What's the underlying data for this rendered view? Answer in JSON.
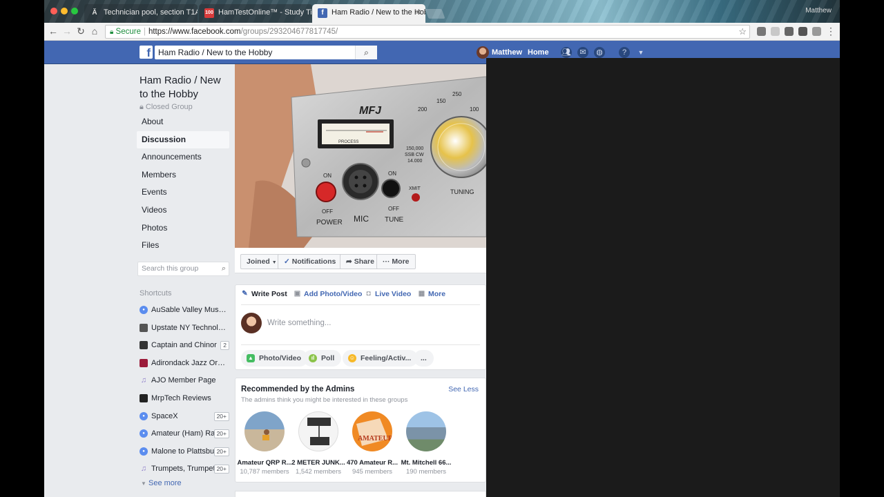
{
  "browser": {
    "tabs": [
      {
        "label": "Technician pool, section T1A",
        "active": false
      },
      {
        "label": "HamTestOnline™ - Study Tips",
        "active": false
      },
      {
        "label": "Ham Radio / New to the Hobby",
        "active": true
      }
    ],
    "profile_name": "Matthew",
    "secure_label": "Secure",
    "url_scheme_host": "https://www.facebook.com",
    "url_path": "/groups/293204677817745/"
  },
  "fb": {
    "logo": "f",
    "search_value": "Ham Radio / New to the Hobby",
    "user_name": "Matthew",
    "home_label": "Home"
  },
  "group": {
    "title": "Ham Radio / New to the Hobby",
    "privacy": "Closed Group",
    "nav": [
      {
        "label": "About"
      },
      {
        "label": "Discussion",
        "active": true
      },
      {
        "label": "Announcements"
      },
      {
        "label": "Members"
      },
      {
        "label": "Events"
      },
      {
        "label": "Videos"
      },
      {
        "label": "Photos"
      },
      {
        "label": "Files"
      }
    ],
    "search_placeholder": "Search this group",
    "shortcuts_title": "Shortcuts",
    "shortcuts": [
      {
        "label": "AuSable Valley Music Al...",
        "count": "",
        "icon": "group-icon",
        "color": "#5b8def"
      },
      {
        "label": "Upstate NY Technology...",
        "count": "",
        "icon": "group-photo-icon",
        "color": "#555555"
      },
      {
        "label": "Captain and Chinor",
        "count": "2",
        "icon": "group-photo-icon",
        "color": "#333333"
      },
      {
        "label": "Adirondack Jazz Orche...",
        "count": "",
        "icon": "group-photo-icon",
        "color": "#9b1b3a"
      },
      {
        "label": "AJO Member Page",
        "count": "",
        "icon": "music-note-icon",
        "color": "#8f7fc9"
      },
      {
        "label": "MrpTech Reviews",
        "count": "",
        "icon": "group-photo-icon",
        "color": "#222222"
      },
      {
        "label": "SpaceX",
        "count": "20+",
        "icon": "group-icon",
        "color": "#5b8def"
      },
      {
        "label": "Amateur (Ham) Ra...",
        "count": "20+",
        "icon": "group-icon",
        "color": "#5b8def"
      },
      {
        "label": "Malone to Plattsbu...",
        "count": "20+",
        "icon": "group-icon",
        "color": "#5b8def"
      },
      {
        "label": "Trumpets, Trumpet...",
        "count": "20+",
        "icon": "music-note-icon",
        "color": "#8f7fc9"
      }
    ],
    "see_more": "See more"
  },
  "cover_actions": {
    "joined": "Joined",
    "notifications": "Notifications",
    "share": "Share",
    "more": "More"
  },
  "device": {
    "brand": "MFJ",
    "meter_label": "PROCESS",
    "on_left": "ON",
    "off_left": "OFF",
    "power": "POWER",
    "mic": "MIC",
    "on_right": "ON",
    "off_right": "OFF",
    "tune": "TUNE",
    "xmit": "XMIT",
    "tuning": "TUNING",
    "dial_marks": [
      "250",
      "200",
      "150",
      "100"
    ],
    "dial_extra": [
      "150,000",
      "SSB CW",
      "14.000"
    ]
  },
  "composer": {
    "tabs": [
      "Write Post",
      "Add Photo/Video",
      "Live Video",
      "More"
    ],
    "placeholder": "Write something...",
    "actions": [
      "Photo/Video",
      "Poll",
      "Feeling/Activ...",
      "..."
    ]
  },
  "recommended": {
    "title": "Recommended by the Admins",
    "subtitle": "The admins think you might be interested in these groups",
    "see_less": "See Less",
    "groups": [
      {
        "name": "Amateur QRP R...",
        "members": "10,787 members"
      },
      {
        "name": "2 METER JUNK...",
        "members": "1,542 members"
      },
      {
        "name": "470 Amateur R...",
        "members": "945 members"
      },
      {
        "name": "Mt. Mitchell 66...",
        "members": "190 members"
      }
    ],
    "badge_text": "AMATEUR"
  },
  "colors": {
    "fb_blue": "#4267b2",
    "link_blue": "#4267b2",
    "secure_green": "#1e8e3e"
  }
}
